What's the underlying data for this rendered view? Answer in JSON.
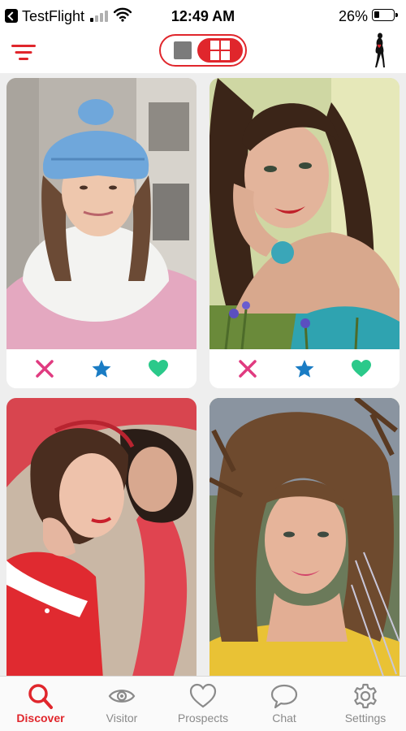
{
  "status_bar": {
    "app_name": "TestFlight",
    "time": "12:49 AM",
    "battery_percent": "26%"
  },
  "header": {
    "view_mode": "grid"
  },
  "cards": [
    {
      "actions": [
        "dislike-icon",
        "star-icon",
        "heart-icon"
      ]
    },
    {
      "actions": [
        "dislike-icon",
        "star-icon",
        "heart-icon"
      ]
    },
    {
      "actions": []
    },
    {
      "actions": []
    }
  ],
  "tabs": [
    {
      "label": "Discover",
      "icon": "search-icon",
      "active": true
    },
    {
      "label": "Visitor",
      "icon": "eye-icon",
      "active": false
    },
    {
      "label": "Prospects",
      "icon": "heart-icon",
      "active": false
    },
    {
      "label": "Chat",
      "icon": "chat-bubble-icon",
      "active": false
    },
    {
      "label": "Settings",
      "icon": "gear-icon",
      "active": false
    }
  ],
  "colors": {
    "accent": "#e0262c",
    "dislike": "#e03b80",
    "star": "#1a7cc4",
    "like": "#2bc98a",
    "inactive": "#8a8a8a"
  }
}
